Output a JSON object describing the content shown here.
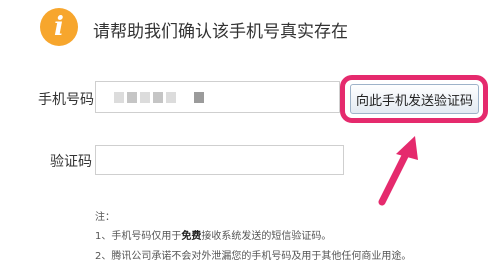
{
  "header": {
    "icon_glyph": "i",
    "title": "请帮助我们确认该手机号真实存在"
  },
  "form": {
    "phone_label": "手机号码",
    "phone_value_masked": true,
    "send_button_label": "向此手机发送验证码",
    "code_label": "验证码",
    "code_value": ""
  },
  "notes": {
    "title": "注：",
    "line1_prefix": "1、手机号码仅用于",
    "line1_bold": "免费",
    "line1_suffix": "接收系统发送的短信验证码。",
    "line2": "2、腾讯公司承诺不会对外泄漏您的手机号码及用于其他任何商业用途。"
  },
  "annotation": {
    "highlight_color": "#e52a6d"
  }
}
